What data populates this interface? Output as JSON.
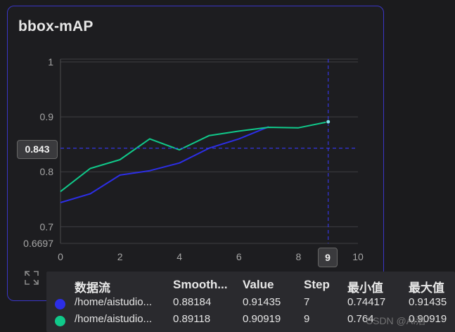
{
  "card": {
    "title": "bbox-mAP"
  },
  "chart_data": {
    "type": "line",
    "title": "bbox-mAP",
    "x": [
      0,
      1,
      2,
      3,
      4,
      5,
      6,
      7,
      8,
      9
    ],
    "xlim": [
      0,
      10
    ],
    "ylim": [
      0.6697,
      1
    ],
    "x_ticks": [
      "0",
      "2",
      "4",
      "6",
      "8",
      "10"
    ],
    "x_tick_values": [
      0,
      2,
      4,
      6,
      8,
      10
    ],
    "y_ticks": [
      "1",
      "0.9",
      "0.8",
      "0.7",
      "0.6697"
    ],
    "y_tick_values": [
      1,
      0.9,
      0.8,
      0.7,
      0.6697
    ],
    "grid": true,
    "series": [
      {
        "name": "/home/aistudio...",
        "color": "#2c2ee6",
        "values": [
          0.744,
          0.76,
          0.794,
          0.802,
          0.816,
          0.843,
          0.86,
          0.882,
          null,
          null
        ]
      },
      {
        "name": "/home/aistudio...",
        "color": "#10c98a",
        "values": [
          0.764,
          0.806,
          0.822,
          0.86,
          0.84,
          0.866,
          0.874,
          0.881,
          0.88,
          0.891
        ]
      }
    ],
    "crosshair": {
      "x": 9,
      "y": 0.843,
      "x_label": "9",
      "y_label": "0.843"
    }
  },
  "tooltip": {
    "headers": [
      "数据流",
      "Smooth...",
      "Value",
      "Step",
      "最小值",
      "最大值"
    ],
    "rows": [
      {
        "color": "#2c2ee6",
        "cells": [
          "/home/aistudio...",
          "0.88184",
          "0.91435",
          "7",
          "0.74417",
          "0.91435"
        ]
      },
      {
        "color": "#10c98a",
        "cells": [
          "/home/aistudio...",
          "0.89118",
          "0.90919",
          "9",
          "0.764",
          "0.90919"
        ]
      }
    ]
  },
  "watermark": "CSDN @AI浩"
}
